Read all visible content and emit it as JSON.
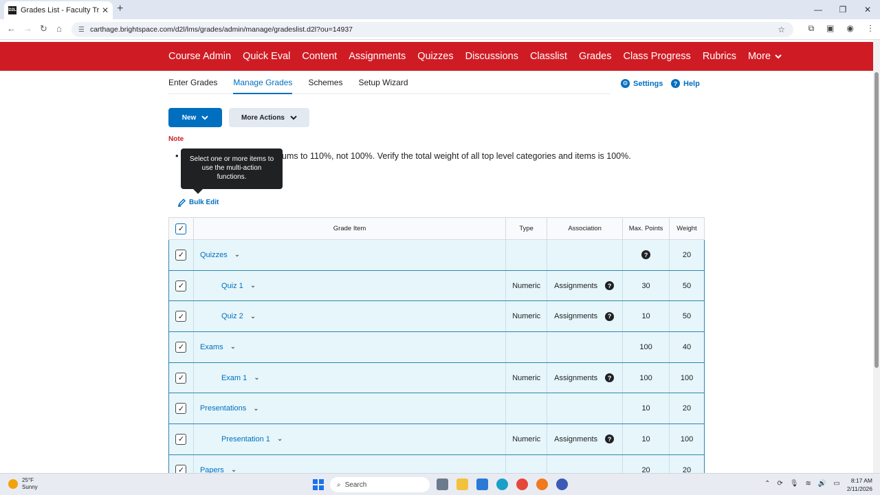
{
  "browser": {
    "tab_title": "Grades List - Faculty Training C...",
    "favicon_text": "D2L",
    "url": "carthage.brightspace.com/d2l/lms/grades/admin/manage/gradeslist.d2l?ou=14937"
  },
  "nav": {
    "items": [
      "Course Admin",
      "Quick Eval",
      "Content",
      "Assignments",
      "Quizzes",
      "Discussions",
      "Classlist",
      "Grades",
      "Class Progress",
      "Rubrics"
    ],
    "more_label": "More"
  },
  "subtabs": {
    "items": [
      "Enter Grades",
      "Manage Grades",
      "Schemes",
      "Setup Wizard"
    ],
    "active": "Manage Grades",
    "settings_label": "Settings",
    "help_label": "Help"
  },
  "actions": {
    "new_label": "New",
    "more_actions_label": "More Actions",
    "bulk_edit_label": "Bulk Edit"
  },
  "note": {
    "label": "Note",
    "text": "ums to 110%, not 100%. Verify the total weight of all top level categories and items is 100%."
  },
  "tooltip": {
    "text": "Select one or more items to use the multi-action functions."
  },
  "table": {
    "headers": {
      "grade_item": "Grade Item",
      "type": "Type",
      "association": "Association",
      "max_points": "Max. Points",
      "weight": "Weight"
    },
    "rows": [
      {
        "name": "Quizzes",
        "level": "category",
        "type": "",
        "association": "",
        "max_points": "?",
        "weight": "20"
      },
      {
        "name": "Quiz 1",
        "level": "item",
        "type": "Numeric",
        "association": "Assignments",
        "max_points": "30",
        "weight": "50"
      },
      {
        "name": "Quiz 2",
        "level": "item",
        "type": "Numeric",
        "association": "Assignments",
        "max_points": "10",
        "weight": "50"
      },
      {
        "name": "Exams",
        "level": "category",
        "type": "",
        "association": "",
        "max_points": "100",
        "weight": "40"
      },
      {
        "name": "Exam 1",
        "level": "item",
        "type": "Numeric",
        "association": "Assignments",
        "max_points": "100",
        "weight": "100"
      },
      {
        "name": "Presentations",
        "level": "category",
        "type": "",
        "association": "",
        "max_points": "10",
        "weight": "20"
      },
      {
        "name": "Presentation 1",
        "level": "item",
        "type": "Numeric",
        "association": "Assignments",
        "max_points": "10",
        "weight": "100"
      },
      {
        "name": "Papers",
        "level": "category",
        "type": "",
        "association": "",
        "max_points": "20",
        "weight": "20"
      }
    ]
  },
  "taskbar": {
    "temperature": "25°F",
    "weather": "Sunny",
    "search_placeholder": "Search",
    "time": "8:17 AM",
    "date": "2/11/2026"
  },
  "colors": {
    "brand_red": "#cf1c24",
    "link_blue": "#006fbf",
    "selected_row": "#e6f6fb"
  }
}
